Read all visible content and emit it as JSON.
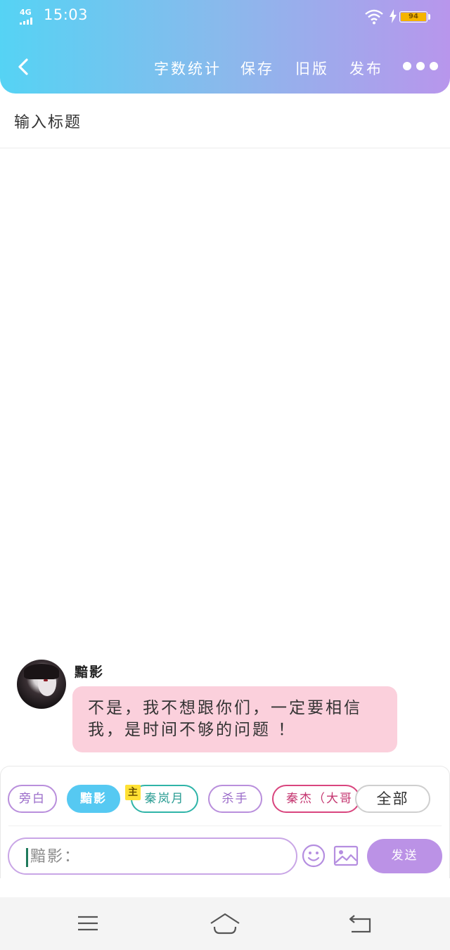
{
  "status_bar": {
    "network": "4G",
    "time": "15:03",
    "battery": "94"
  },
  "nav": {
    "word_count": "字数统计",
    "save": "保存",
    "old_version": "旧版",
    "publish": "发布"
  },
  "editor": {
    "title_placeholder": "输入标题"
  },
  "message": {
    "sender": "黯影",
    "text": "不是，我不想跟你们，一定要相信我，是时间不够的问题 ！"
  },
  "characters": {
    "host_badge": "主",
    "items": [
      {
        "label": "旁白"
      },
      {
        "label": "黯影"
      },
      {
        "label": "秦岚月"
      },
      {
        "label": "杀手"
      },
      {
        "label": "秦杰（大哥"
      },
      {
        "label": "全部"
      }
    ],
    "selected": "黯影"
  },
  "composer": {
    "input_placeholder": "黯影：",
    "send_label": "发送"
  },
  "colors": {
    "header_start": "#55d3f4",
    "header_end": "#b896ec",
    "bubble": "#fbd0dc",
    "active_chip": "#56c9f2",
    "send": "#bb92e6"
  }
}
